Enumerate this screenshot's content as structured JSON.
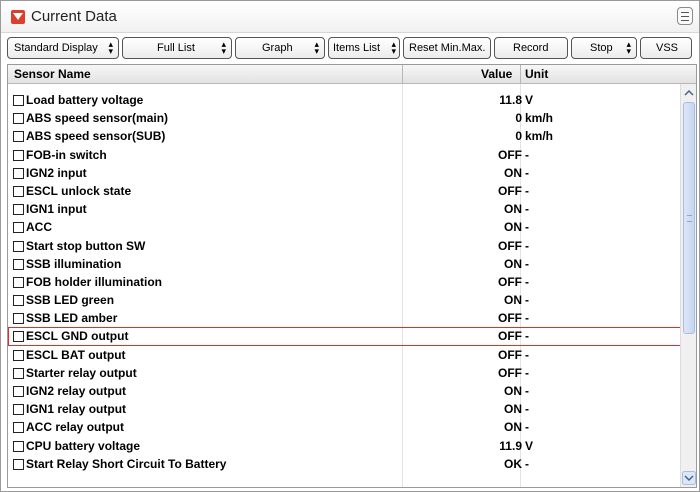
{
  "window": {
    "title": "Current Data"
  },
  "toolbar": {
    "standard_display": "Standard Display",
    "full_list": "Full List",
    "graph": "Graph",
    "items_list": "Items List",
    "reset_minmax": "Reset Min.Max.",
    "record": "Record",
    "stop": "Stop",
    "vss": "VSS"
  },
  "columns": {
    "sensor": "Sensor Name",
    "value": "Value",
    "unit": "Unit"
  },
  "rows": [
    {
      "name": "Load battery voltage",
      "value": "11.8",
      "unit": "V"
    },
    {
      "name": "ABS speed sensor(main)",
      "value": "0",
      "unit": "km/h"
    },
    {
      "name": "ABS speed sensor(SUB)",
      "value": "0",
      "unit": "km/h"
    },
    {
      "name": "FOB-in switch",
      "value": "OFF",
      "unit": "-"
    },
    {
      "name": "IGN2 input",
      "value": "ON",
      "unit": "-"
    },
    {
      "name": "ESCL unlock state",
      "value": "OFF",
      "unit": "-"
    },
    {
      "name": "IGN1 input",
      "value": "ON",
      "unit": "-"
    },
    {
      "name": "ACC",
      "value": "ON",
      "unit": "-"
    },
    {
      "name": "Start stop button SW",
      "value": "OFF",
      "unit": "-"
    },
    {
      "name": "SSB illumination",
      "value": "ON",
      "unit": "-"
    },
    {
      "name": "FOB holder illumination",
      "value": "OFF",
      "unit": "-"
    },
    {
      "name": "SSB LED green",
      "value": "ON",
      "unit": "-"
    },
    {
      "name": "SSB LED amber",
      "value": "OFF",
      "unit": "-"
    },
    {
      "name": "ESCL GND output",
      "value": "OFF",
      "unit": "-"
    },
    {
      "name": "ESCL BAT output",
      "value": "OFF",
      "unit": "-"
    },
    {
      "name": "Starter relay output",
      "value": "OFF",
      "unit": "-"
    },
    {
      "name": "IGN2 relay output",
      "value": "ON",
      "unit": "-"
    },
    {
      "name": "IGN1 relay output",
      "value": "ON",
      "unit": "-"
    },
    {
      "name": "ACC relay output",
      "value": "ON",
      "unit": "-"
    },
    {
      "name": "CPU battery voltage",
      "value": "11.9",
      "unit": "V"
    },
    {
      "name": "Start Relay Short Circuit To Battery",
      "value": "OK",
      "unit": "-"
    }
  ],
  "colors": {
    "selected_outline": "#e0302a",
    "collapse_button": "#d9402d"
  }
}
